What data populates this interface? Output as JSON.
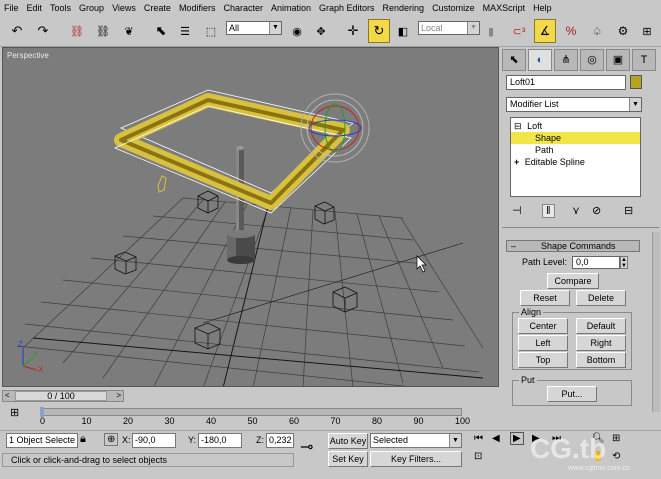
{
  "menu": [
    "File",
    "Edit",
    "Tools",
    "Group",
    "Views",
    "Create",
    "Modifiers",
    "Character",
    "Animation",
    "Graph Editors",
    "Rendering",
    "Customize",
    "MAXScript",
    "Help"
  ],
  "toolbar": {
    "selection_filter": "All",
    "ref_coord": "Local",
    "icons": [
      "undo-icon",
      "redo-icon",
      "link-icon",
      "unlink-icon",
      "bind-spacewarp-icon",
      "select-icon",
      "select-by-name-icon",
      "rect-region-icon",
      "select-move-icon",
      "select-rotate-icon",
      "select-scale-icon",
      "mirror-icon",
      "align-icon",
      "angle-snap-icon",
      "percent-snap-icon",
      "teapot-render-icon"
    ]
  },
  "viewport": {
    "label": "Perspective",
    "axis_labels": [
      "Z",
      "X",
      "Y"
    ],
    "colors": {
      "background": "#7c7c7c",
      "grid": "#3a3a3a",
      "loft": "#b8a020",
      "gizmo_red": "#cc2020",
      "gizmo_green": "#20a020",
      "gizmo_blue": "#2040d0"
    }
  },
  "command_panel": {
    "object_name": "Loft01",
    "object_color": "#b8a020",
    "modifier_list": "Modifier List",
    "stack": [
      {
        "label": "Loft",
        "prefix": "⊟",
        "selected": false,
        "indent": 0
      },
      {
        "label": "Shape",
        "prefix": "",
        "selected": true,
        "indent": 1
      },
      {
        "label": "Path",
        "prefix": "",
        "selected": false,
        "indent": 1
      },
      {
        "label": "Editable Spline",
        "prefix": "+",
        "selected": false,
        "indent": 0
      }
    ],
    "rollout_title": "Shape Commands",
    "path_level_label": "Path Level:",
    "path_level_value": "0,0",
    "compare": "Compare",
    "reset": "Reset",
    "delete": "Delete",
    "align_title": "Align",
    "center": "Center",
    "default": "Default",
    "left": "Left",
    "right": "Right",
    "top": "Top",
    "bottom": "Bottom",
    "put_title": "Put",
    "put_button": "Put..."
  },
  "timeline": {
    "slider_label": "0 / 100",
    "ticks": [
      "0",
      "10",
      "20",
      "30",
      "40",
      "50",
      "60",
      "70",
      "80",
      "90",
      "100"
    ]
  },
  "status": {
    "selection": "1 Object Selecte",
    "x_label": "X:",
    "x_value": "-90,0",
    "y_label": "Y:",
    "y_value": "-180,0",
    "z_label": "Z:",
    "z_value": "0,232",
    "auto_key": "Auto Key",
    "set_key": "Set Key",
    "key_mode": "Selected",
    "key_filters": "Key Filters...",
    "prompt": "Click or click-and-drag to select objects",
    "watermark": "CG.tb",
    "watermark_url": "www.cgtime.com.cn"
  }
}
